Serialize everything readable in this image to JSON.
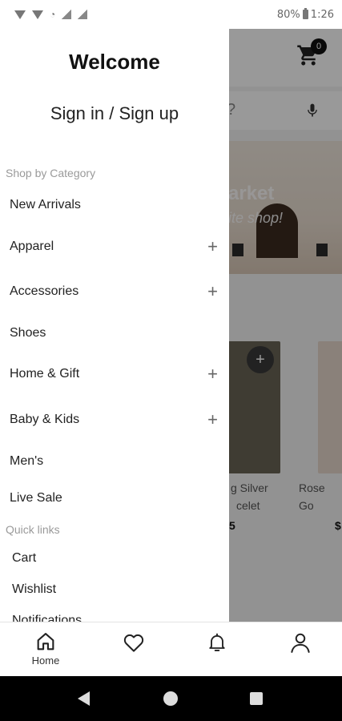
{
  "status_bar": {
    "battery": "80%",
    "time": "1:26"
  },
  "app": {
    "cart_count": "0",
    "search_hint": "?",
    "banner": {
      "line1": "arket",
      "line2": "ite shop!"
    },
    "products": [
      {
        "name_line1": "g Silver",
        "name_line2": "celet",
        "price": "5"
      },
      {
        "name_line1": "Rose Go",
        "name_line2": "",
        "price": "$"
      }
    ]
  },
  "drawer": {
    "title": "Welcome",
    "sign_in": "Sign in / Sign up",
    "category_label": "Shop by Category",
    "categories": [
      {
        "label": "New Arrivals",
        "expandable": false
      },
      {
        "label": "Apparel",
        "expandable": true
      },
      {
        "label": "Accessories",
        "expandable": true
      },
      {
        "label": "Shoes",
        "expandable": false
      },
      {
        "label": "Home & Gift",
        "expandable": true
      },
      {
        "label": "Baby & Kids",
        "expandable": true
      },
      {
        "label": "Men's",
        "expandable": false
      },
      {
        "label": "Live Sale",
        "expandable": false
      }
    ],
    "quick_links_label": "Quick links",
    "quick_links": [
      "Cart",
      "Wishlist",
      "Notifications"
    ],
    "expand_symbol": "+"
  },
  "bottom_nav": {
    "home_label": "Home",
    "icons": [
      "home-icon",
      "heart-icon",
      "bell-icon",
      "user-icon"
    ]
  },
  "colors": {
    "scrim": "#000000",
    "drawer_bg": "#ffffff",
    "section_label": "#9a9a9a",
    "text": "#222222"
  }
}
